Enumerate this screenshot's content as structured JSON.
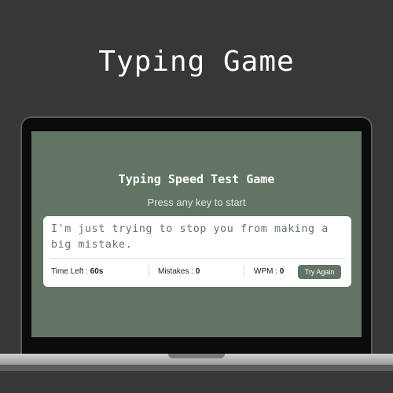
{
  "banner": {
    "title": "Typing Game"
  },
  "game": {
    "title": "Typing Speed Test Game",
    "subtitle": "Press any key to start",
    "text": "I'm just trying to stop you from making a big mistake.",
    "stats": {
      "time_left_label": "Time Left :",
      "time_left_value": "60s",
      "mistakes_label": "Mistakes :",
      "mistakes_value": "0",
      "wpm_label": "WPM :",
      "wpm_value": "0"
    },
    "try_again_label": "Try Again"
  },
  "colors": {
    "background": "#373737",
    "screen": "#627564",
    "accent": "#627564",
    "card": "#ffffff"
  }
}
